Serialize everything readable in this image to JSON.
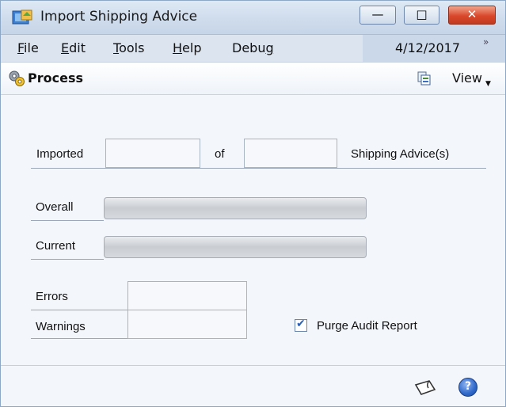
{
  "window": {
    "title": "Import Shipping Advice"
  },
  "titlebar_buttons": {
    "minimize": "—",
    "maximize": "□",
    "close": "✕"
  },
  "menu": {
    "items": [
      {
        "label_first": "F",
        "label_rest": "ile"
      },
      {
        "label_first": "E",
        "label_rest": "dit"
      },
      {
        "label_first": "T",
        "label_rest": "ools"
      },
      {
        "label_first": "H",
        "label_rest": "elp"
      },
      {
        "label_prefix": "Debu",
        "label_underlined": "g"
      }
    ],
    "date": "4/12/2017",
    "overflow": "»"
  },
  "toolbar": {
    "process_label": "Process",
    "view_label": "View"
  },
  "form": {
    "imported_label": "Imported",
    "of_label": "of",
    "shipping_advice_label": "Shipping Advice(s)",
    "imported_value": "",
    "total_value": "",
    "overall_label": "Overall",
    "current_label": "Current",
    "overall_progress": 0,
    "current_progress": 0,
    "errors_label": "Errors",
    "warnings_label": "Warnings",
    "errors_value": "",
    "warnings_value": "",
    "purge_label": "Purge Audit Report",
    "purge_checked": true
  },
  "icons": {
    "app": "import-shipping-icon",
    "process": "process-gears-icon",
    "view": "view-icon",
    "note": "note-icon",
    "help": "help-icon"
  },
  "colors": {
    "close_button": "#d9482a",
    "menubar": "#dbe4ef",
    "date_area": "#cbd8ea"
  }
}
